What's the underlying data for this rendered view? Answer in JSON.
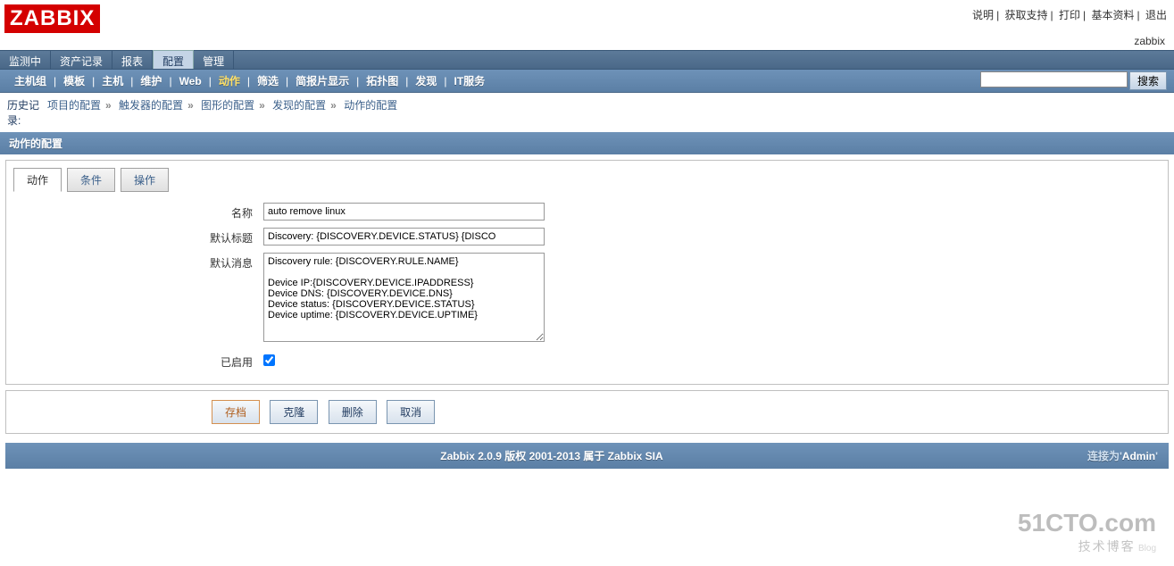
{
  "logo": "ZABBIX",
  "top_links": [
    "说明",
    "获取支持",
    "打印",
    "基本资料",
    "退出"
  ],
  "user_label": "zabbix",
  "main_nav": {
    "items": [
      "监测中",
      "资产记录",
      "报表",
      "配置",
      "管理"
    ],
    "active_index": 3
  },
  "sub_nav": {
    "items": [
      "主机组",
      "模板",
      "主机",
      "维护",
      "Web",
      "动作",
      "筛选",
      "简报片显示",
      "拓扑图",
      "发现",
      "IT服务"
    ],
    "active_index": 5
  },
  "search": {
    "placeholder": "",
    "button": "搜索"
  },
  "history": {
    "label": "历史记录:",
    "items": [
      "项目的配置",
      "触发器的配置",
      "图形的配置",
      "发现的配置",
      "动作的配置"
    ]
  },
  "section_title": "动作的配置",
  "form_tabs": {
    "items": [
      "动作",
      "条件",
      "操作"
    ],
    "active_index": 0
  },
  "form": {
    "name_label": "名称",
    "name_value": "auto remove linux",
    "subject_label": "默认标题",
    "subject_value": "Discovery: {DISCOVERY.DEVICE.STATUS} {DISCO",
    "message_label": "默认消息",
    "message_value": "Discovery rule: {DISCOVERY.RULE.NAME}\n\nDevice IP:{DISCOVERY.DEVICE.IPADDRESS}\nDevice DNS: {DISCOVERY.DEVICE.DNS}\nDevice status: {DISCOVERY.DEVICE.STATUS}\nDevice uptime: {DISCOVERY.DEVICE.UPTIME}",
    "enabled_label": "已启用",
    "enabled_value": true
  },
  "buttons": {
    "save": "存档",
    "clone": "克隆",
    "delete": "删除",
    "cancel": "取消"
  },
  "footer": {
    "center": "Zabbix 2.0.9 版权 2001-2013 属于 Zabbix SIA",
    "right_prefix": "连接为'",
    "right_user": "Admin",
    "right_suffix": "'"
  },
  "watermark": {
    "big": "51CTO.com",
    "small": "技术博客",
    "blog": "Blog"
  }
}
